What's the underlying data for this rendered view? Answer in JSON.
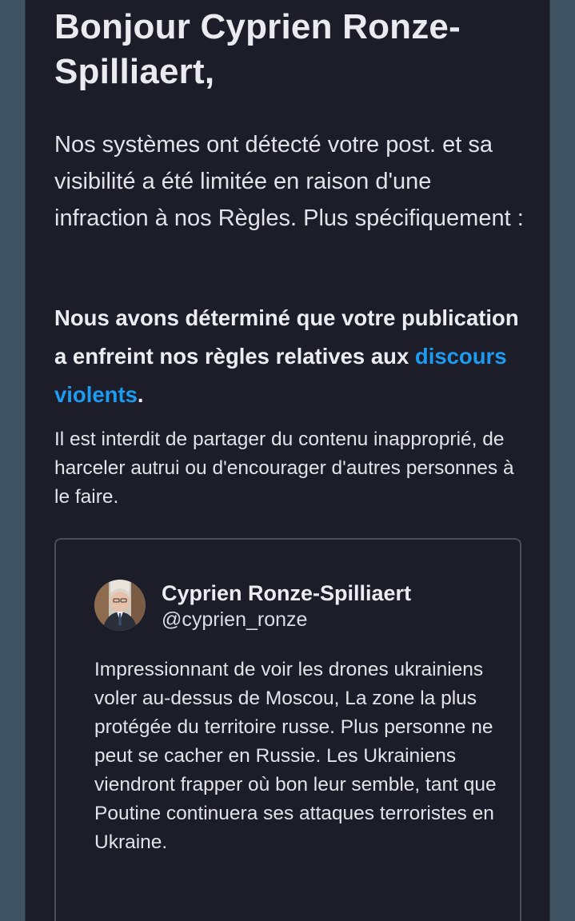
{
  "colors": {
    "card_background": "#1c1d28",
    "side_background": "#3f5363",
    "text_primary": "#e2e2e8",
    "link": "#1d9bf0",
    "tweet_border": "#4a4c58"
  },
  "email": {
    "greeting": "Bonjour Cyprien Ronze-Spilliaert,",
    "intro": "Nos systèmes ont détecté votre post. et sa visibilité a été limitée en raison d'une infraction à nos Règles. Plus spécifiquement :",
    "violation_prefix": "Nous avons déterminé que votre publication a enfreint nos règles relatives aux ",
    "violation_link": "discours violents",
    "violation_suffix": ".",
    "explanation": "Il est interdit de partager du contenu inapproprié, de harceler autrui ou d'encourager d'autres personnes à le faire."
  },
  "tweet": {
    "avatar_icon": "user-avatar-photo",
    "author_name": "Cyprien Ronze-Spilliaert",
    "author_handle": "@cyprien_ronze",
    "text": "Impressionnant de voir les drones ukrainiens voler au-dessus de Moscou, La zone la plus protégée du territoire russe. Plus personne ne peut se cacher en Russie. Les Ukrainiens viendront frapper où bon leur semble, tant que Poutine continuera ses attaques terroristes en Ukraine."
  }
}
